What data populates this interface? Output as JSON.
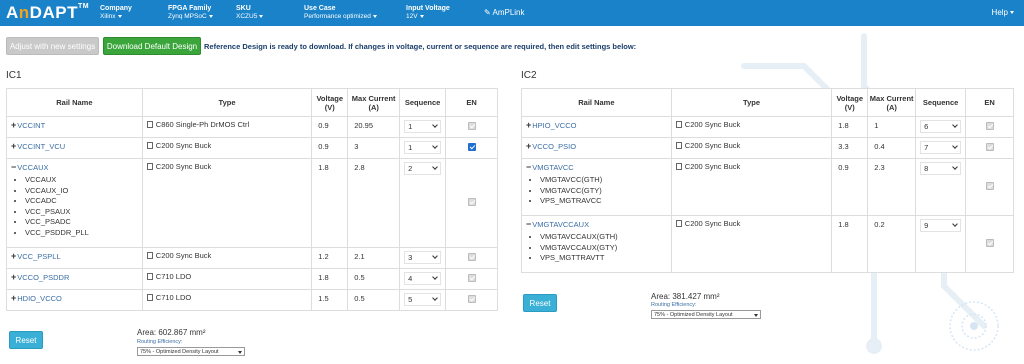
{
  "header": {
    "logo_prefix": "A",
    "logo_accent": "n",
    "logo_suffix": "DAPT",
    "logo_tm": "TM",
    "nav": [
      {
        "label": "Company",
        "value": "Xilinx"
      },
      {
        "label": "FPGA Family",
        "value": "Zynq MPSoC"
      },
      {
        "label": "SKU",
        "value": "XCZU5"
      },
      {
        "label": "Use Case",
        "value": "Performance optimized"
      },
      {
        "label": "Input Voltage",
        "value": "12V"
      }
    ],
    "amplink": "AmPLink",
    "help": "Help"
  },
  "toolbar": {
    "adjust_label": "Adjust with new settings",
    "download_label": "Download Default Design",
    "notice": "Reference Design is ready to download. If changes in voltage, current or sequence are required, then edit settings below:"
  },
  "columns": {
    "rail": "Rail Name",
    "type": "Type",
    "voltage": "Voltage (V)",
    "current": "Max Current (A)",
    "sequence": "Sequence",
    "en": "EN"
  },
  "ic1": {
    "title": "IC1",
    "rows": [
      {
        "name": "VCCINT",
        "sign": "+",
        "sub": [],
        "type": "C860 Single-Ph DrMOS Ctrl",
        "voltage": "0.9",
        "current": "20.95",
        "sequence": "1",
        "en": false
      },
      {
        "name": "VCCINT_VCU",
        "sign": "+",
        "sub": [],
        "type": "C200 Sync Buck",
        "voltage": "0.9",
        "current": "3",
        "sequence": "1",
        "en": true
      },
      {
        "name": "VCCAUX",
        "sign": "−",
        "sub": [
          "VCCAUX",
          "VCCAUX_IO",
          "VCCADC",
          "VCC_PSAUX",
          "VCC_PSADC",
          "VCC_PSDDR_PLL"
        ],
        "type": "C200 Sync Buck",
        "voltage": "1.8",
        "current": "2.8",
        "sequence": "2",
        "en": false
      },
      {
        "name": "VCC_PSPLL",
        "sign": "+",
        "sub": [],
        "type": "C200 Sync Buck",
        "voltage": "1.2",
        "current": "2.1",
        "sequence": "3",
        "en": false
      },
      {
        "name": "VCCO_PSDDR",
        "sign": "+",
        "sub": [],
        "type": "C710 LDO",
        "voltage": "1.8",
        "current": "0.5",
        "sequence": "4",
        "en": false
      },
      {
        "name": "HDIO_VCCO",
        "sign": "+",
        "sub": [],
        "type": "C710 LDO",
        "voltage": "1.5",
        "current": "0.5",
        "sequence": "5",
        "en": false
      }
    ],
    "reset": "Reset",
    "area": "Area: 602.867 mm²",
    "routing_label": "Routing Efficiency:",
    "routing_value": "75% - Optimized Density Layout"
  },
  "ic2": {
    "title": "IC2",
    "rows": [
      {
        "name": "HPIO_VCCO",
        "sign": "+",
        "sub": [],
        "type": "C200 Sync Buck",
        "voltage": "1.8",
        "current": "1",
        "sequence": "6",
        "en": false
      },
      {
        "name": "VCCO_PSIO",
        "sign": "+",
        "sub": [],
        "type": "C200 Sync Buck",
        "voltage": "3.3",
        "current": "0.4",
        "sequence": "7",
        "en": false
      },
      {
        "name": "VMGTAVCC",
        "sign": "−",
        "sub": [
          "VMGTAVCC(GTH)",
          "VMGTAVCC(GTY)",
          "VPS_MGTRAVCC"
        ],
        "type": "C200 Sync Buck",
        "voltage": "0.9",
        "current": "2.3",
        "sequence": "8",
        "en": false
      },
      {
        "name": "VMGTAVCCAUX",
        "sign": "−",
        "sub": [
          "VMGTAVCCAUX(GTH)",
          "VMGTAVCCAUX(GTY)",
          "VPS_MGTTRAVTT"
        ],
        "type": "C200 Sync Buck",
        "voltage": "1.8",
        "current": "0.2",
        "sequence": "9",
        "en": false
      }
    ],
    "reset": "Reset",
    "area": "Area: 381.427 mm²",
    "routing_label": "Routing Efficiency:",
    "routing_value": "75% - Optimized Density Layout"
  },
  "colors": {
    "topbar": "#1a82c8",
    "accent": "#f7a21b",
    "download": "#3aa53a",
    "reset": "#3bb0d6"
  }
}
